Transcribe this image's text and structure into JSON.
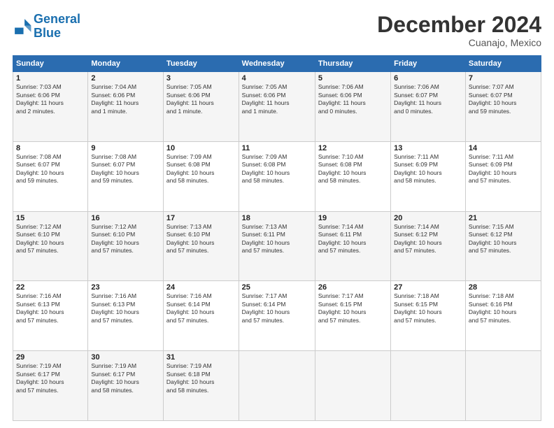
{
  "header": {
    "logo_line1": "General",
    "logo_line2": "Blue",
    "month": "December 2024",
    "location": "Cuanajo, Mexico"
  },
  "weekdays": [
    "Sunday",
    "Monday",
    "Tuesday",
    "Wednesday",
    "Thursday",
    "Friday",
    "Saturday"
  ],
  "weeks": [
    [
      {
        "day": "1",
        "sunrise": "7:03 AM",
        "sunset": "6:06 PM",
        "daylight": "11 hours and 2 minutes."
      },
      {
        "day": "2",
        "sunrise": "7:04 AM",
        "sunset": "6:06 PM",
        "daylight": "11 hours and 1 minute."
      },
      {
        "day": "3",
        "sunrise": "7:05 AM",
        "sunset": "6:06 PM",
        "daylight": "11 hours and 1 minute."
      },
      {
        "day": "4",
        "sunrise": "7:05 AM",
        "sunset": "6:06 PM",
        "daylight": "11 hours and 1 minute."
      },
      {
        "day": "5",
        "sunrise": "7:06 AM",
        "sunset": "6:06 PM",
        "daylight": "11 hours and 0 minutes."
      },
      {
        "day": "6",
        "sunrise": "7:06 AM",
        "sunset": "6:07 PM",
        "daylight": "11 hours and 0 minutes."
      },
      {
        "day": "7",
        "sunrise": "7:07 AM",
        "sunset": "6:07 PM",
        "daylight": "10 hours and 59 minutes."
      }
    ],
    [
      {
        "day": "8",
        "sunrise": "7:08 AM",
        "sunset": "6:07 PM",
        "daylight": "10 hours and 59 minutes."
      },
      {
        "day": "9",
        "sunrise": "7:08 AM",
        "sunset": "6:07 PM",
        "daylight": "10 hours and 59 minutes."
      },
      {
        "day": "10",
        "sunrise": "7:09 AM",
        "sunset": "6:08 PM",
        "daylight": "10 hours and 58 minutes."
      },
      {
        "day": "11",
        "sunrise": "7:09 AM",
        "sunset": "6:08 PM",
        "daylight": "10 hours and 58 minutes."
      },
      {
        "day": "12",
        "sunrise": "7:10 AM",
        "sunset": "6:08 PM",
        "daylight": "10 hours and 58 minutes."
      },
      {
        "day": "13",
        "sunrise": "7:11 AM",
        "sunset": "6:09 PM",
        "daylight": "10 hours and 58 minutes."
      },
      {
        "day": "14",
        "sunrise": "7:11 AM",
        "sunset": "6:09 PM",
        "daylight": "10 hours and 57 minutes."
      }
    ],
    [
      {
        "day": "15",
        "sunrise": "7:12 AM",
        "sunset": "6:10 PM",
        "daylight": "10 hours and 57 minutes."
      },
      {
        "day": "16",
        "sunrise": "7:12 AM",
        "sunset": "6:10 PM",
        "daylight": "10 hours and 57 minutes."
      },
      {
        "day": "17",
        "sunrise": "7:13 AM",
        "sunset": "6:10 PM",
        "daylight": "10 hours and 57 minutes."
      },
      {
        "day": "18",
        "sunrise": "7:13 AM",
        "sunset": "6:11 PM",
        "daylight": "10 hours and 57 minutes."
      },
      {
        "day": "19",
        "sunrise": "7:14 AM",
        "sunset": "6:11 PM",
        "daylight": "10 hours and 57 minutes."
      },
      {
        "day": "20",
        "sunrise": "7:14 AM",
        "sunset": "6:12 PM",
        "daylight": "10 hours and 57 minutes."
      },
      {
        "day": "21",
        "sunrise": "7:15 AM",
        "sunset": "6:12 PM",
        "daylight": "10 hours and 57 minutes."
      }
    ],
    [
      {
        "day": "22",
        "sunrise": "7:16 AM",
        "sunset": "6:13 PM",
        "daylight": "10 hours and 57 minutes."
      },
      {
        "day": "23",
        "sunrise": "7:16 AM",
        "sunset": "6:13 PM",
        "daylight": "10 hours and 57 minutes."
      },
      {
        "day": "24",
        "sunrise": "7:16 AM",
        "sunset": "6:14 PM",
        "daylight": "10 hours and 57 minutes."
      },
      {
        "day": "25",
        "sunrise": "7:17 AM",
        "sunset": "6:14 PM",
        "daylight": "10 hours and 57 minutes."
      },
      {
        "day": "26",
        "sunrise": "7:17 AM",
        "sunset": "6:15 PM",
        "daylight": "10 hours and 57 minutes."
      },
      {
        "day": "27",
        "sunrise": "7:18 AM",
        "sunset": "6:15 PM",
        "daylight": "10 hours and 57 minutes."
      },
      {
        "day": "28",
        "sunrise": "7:18 AM",
        "sunset": "6:16 PM",
        "daylight": "10 hours and 57 minutes."
      }
    ],
    [
      {
        "day": "29",
        "sunrise": "7:19 AM",
        "sunset": "6:17 PM",
        "daylight": "10 hours and 57 minutes."
      },
      {
        "day": "30",
        "sunrise": "7:19 AM",
        "sunset": "6:17 PM",
        "daylight": "10 hours and 58 minutes."
      },
      {
        "day": "31",
        "sunrise": "7:19 AM",
        "sunset": "6:18 PM",
        "daylight": "10 hours and 58 minutes."
      },
      null,
      null,
      null,
      null
    ]
  ]
}
